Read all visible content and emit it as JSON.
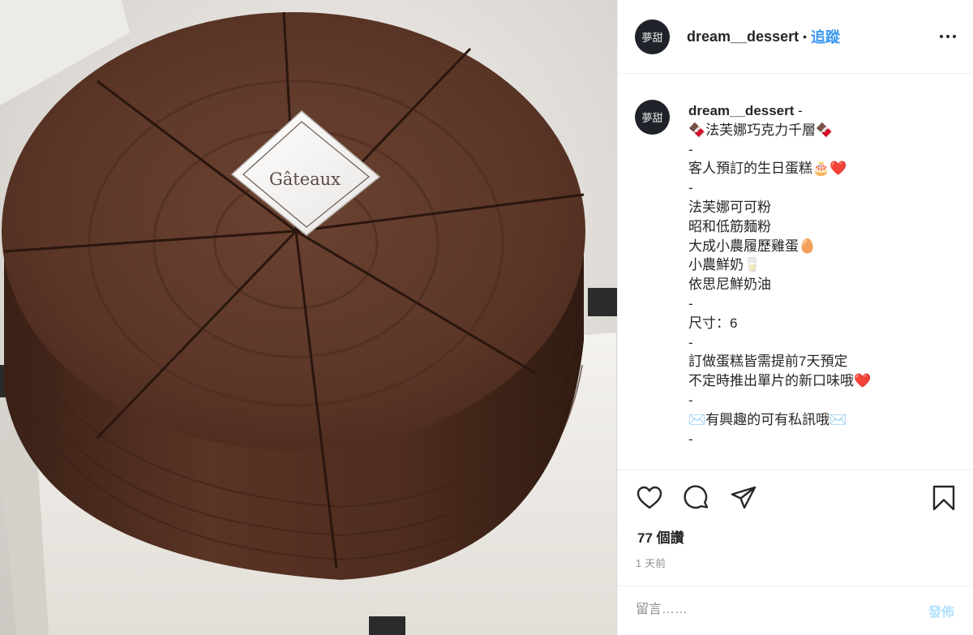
{
  "colors": {
    "accent": "#3897f0",
    "text": "#262626",
    "muted": "#8e8e8e",
    "post_disabled": "#b2dffc",
    "cake": "#5a3526"
  },
  "photo": {
    "topper_text": "Gâteaux"
  },
  "header": {
    "avatar_glyph": "夢甜",
    "username": "dream__dessert",
    "separator": "•",
    "follow_label": "追蹤",
    "more_icon": "more-horizontal-icon"
  },
  "caption": {
    "username": "dream__dessert",
    "first_line": " -",
    "lines": [
      "🍫法芙娜巧克力千層🍫",
      "-",
      "客人預訂的生日蛋糕🎂❤️",
      "-",
      "法芙娜可可粉",
      "昭和低筋麵粉",
      "大成小農履歷雞蛋🥚",
      "小農鮮奶🥛",
      "依思尼鮮奶油",
      "-",
      "尺寸：6",
      "-",
      "訂做蛋糕皆需提前7天預定",
      "不定時推出單片的新口味哦❤️",
      "-",
      "✉️有興趣的可有私訊哦✉️",
      "-"
    ]
  },
  "actions": {
    "like_icon": "heart-icon",
    "comment_icon": "comment-icon",
    "share_icon": "share-icon",
    "save_icon": "bookmark-icon"
  },
  "likes": {
    "text": "77 個讚"
  },
  "time": {
    "text": "1 天前"
  },
  "comment": {
    "placeholder": "留言……",
    "post_label": "發佈"
  }
}
